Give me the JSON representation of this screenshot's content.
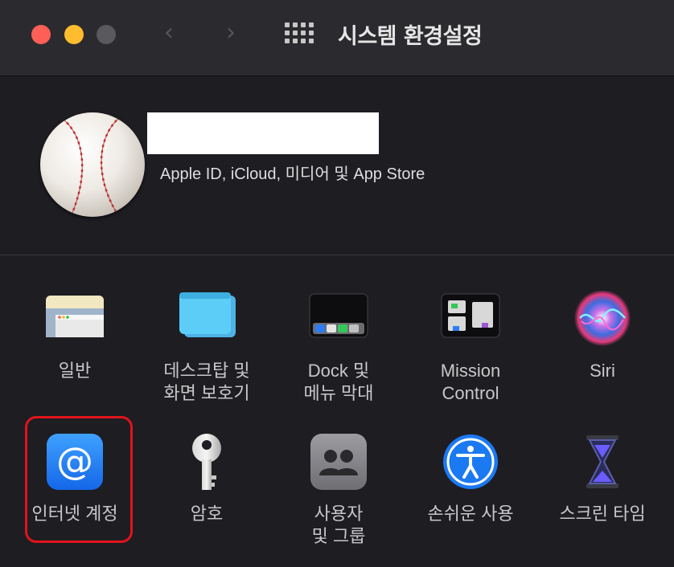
{
  "window": {
    "title": "시스템 환경설정"
  },
  "account": {
    "subtitle": "Apple ID, iCloud, 미디어 및 App Store"
  },
  "preferences": {
    "row1": [
      {
        "label_line1": "일반",
        "label_line2": "",
        "icon": "general-icon"
      },
      {
        "label_line1": "데스크탑 및",
        "label_line2": "화면 보호기",
        "icon": "desktop-screensaver-icon"
      },
      {
        "label_line1": "Dock 및",
        "label_line2": "메뉴 막대",
        "icon": "dock-menubar-icon"
      },
      {
        "label_line1": "Mission",
        "label_line2": "Control",
        "icon": "mission-control-icon"
      },
      {
        "label_line1": "Siri",
        "label_line2": "",
        "icon": "siri-icon"
      }
    ],
    "row2": [
      {
        "label_line1": "인터넷 계정",
        "label_line2": "",
        "icon": "internet-accounts-icon"
      },
      {
        "label_line1": "암호",
        "label_line2": "",
        "icon": "key-icon"
      },
      {
        "label_line1": "사용자",
        "label_line2": "및 그룹",
        "icon": "users-groups-icon"
      },
      {
        "label_line1": "손쉬운 사용",
        "label_line2": "",
        "icon": "accessibility-icon"
      },
      {
        "label_line1": "스크린 타임",
        "label_line2": "",
        "icon": "hourglass-icon"
      }
    ]
  },
  "colors": {
    "highlight": "#e0141b",
    "close": "#fe5f57",
    "minimize": "#febc2e"
  }
}
